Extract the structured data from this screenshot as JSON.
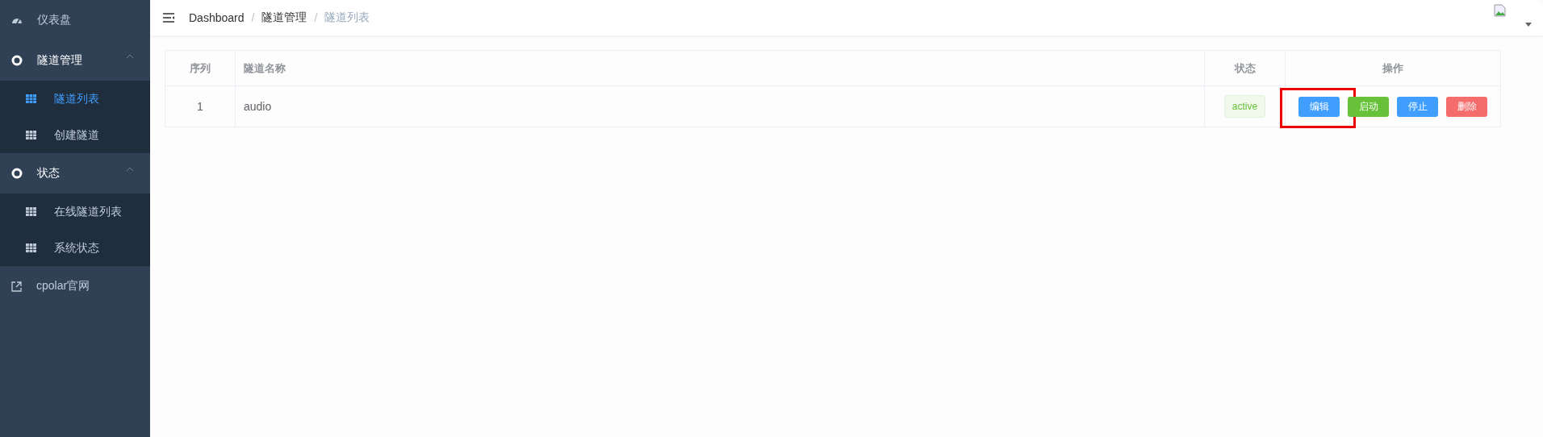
{
  "sidebar": {
    "items": [
      {
        "label": "仪表盘",
        "kind": "dashboard"
      },
      {
        "label": "隧道管理",
        "kind": "group",
        "expanded": true,
        "children": [
          {
            "label": "隧道列表",
            "selected": true
          },
          {
            "label": "创建隧道",
            "selected": false
          }
        ]
      },
      {
        "label": "状态",
        "kind": "group",
        "expanded": true,
        "children": [
          {
            "label": "在线隧道列表",
            "selected": false
          },
          {
            "label": "系统状态",
            "selected": false
          }
        ]
      },
      {
        "label": "cpolar官网",
        "kind": "link"
      }
    ]
  },
  "breadcrumb": [
    {
      "kind": "link",
      "text": "Dashboard"
    },
    {
      "kind": "separator",
      "text": "/"
    },
    {
      "kind": "link",
      "text": "隧道管理"
    },
    {
      "kind": "separator",
      "text": "/"
    },
    {
      "kind": "current",
      "text": "隧道列表"
    }
  ],
  "table": {
    "columns": [
      "序列",
      "隧道名称",
      "状态",
      "操作"
    ],
    "rows": [
      {
        "index": "1",
        "name": "audio",
        "status": "active",
        "actions": [
          {
            "label": "编辑",
            "color": "#409eff",
            "highlighted": true
          },
          {
            "label": "启动",
            "color": "#67c23a",
            "highlighted": false
          },
          {
            "label": "停止",
            "color": "#409eff",
            "highlighted": false
          },
          {
            "label": "删除",
            "color": "#f56c6c",
            "highlighted": false
          }
        ]
      }
    ]
  }
}
